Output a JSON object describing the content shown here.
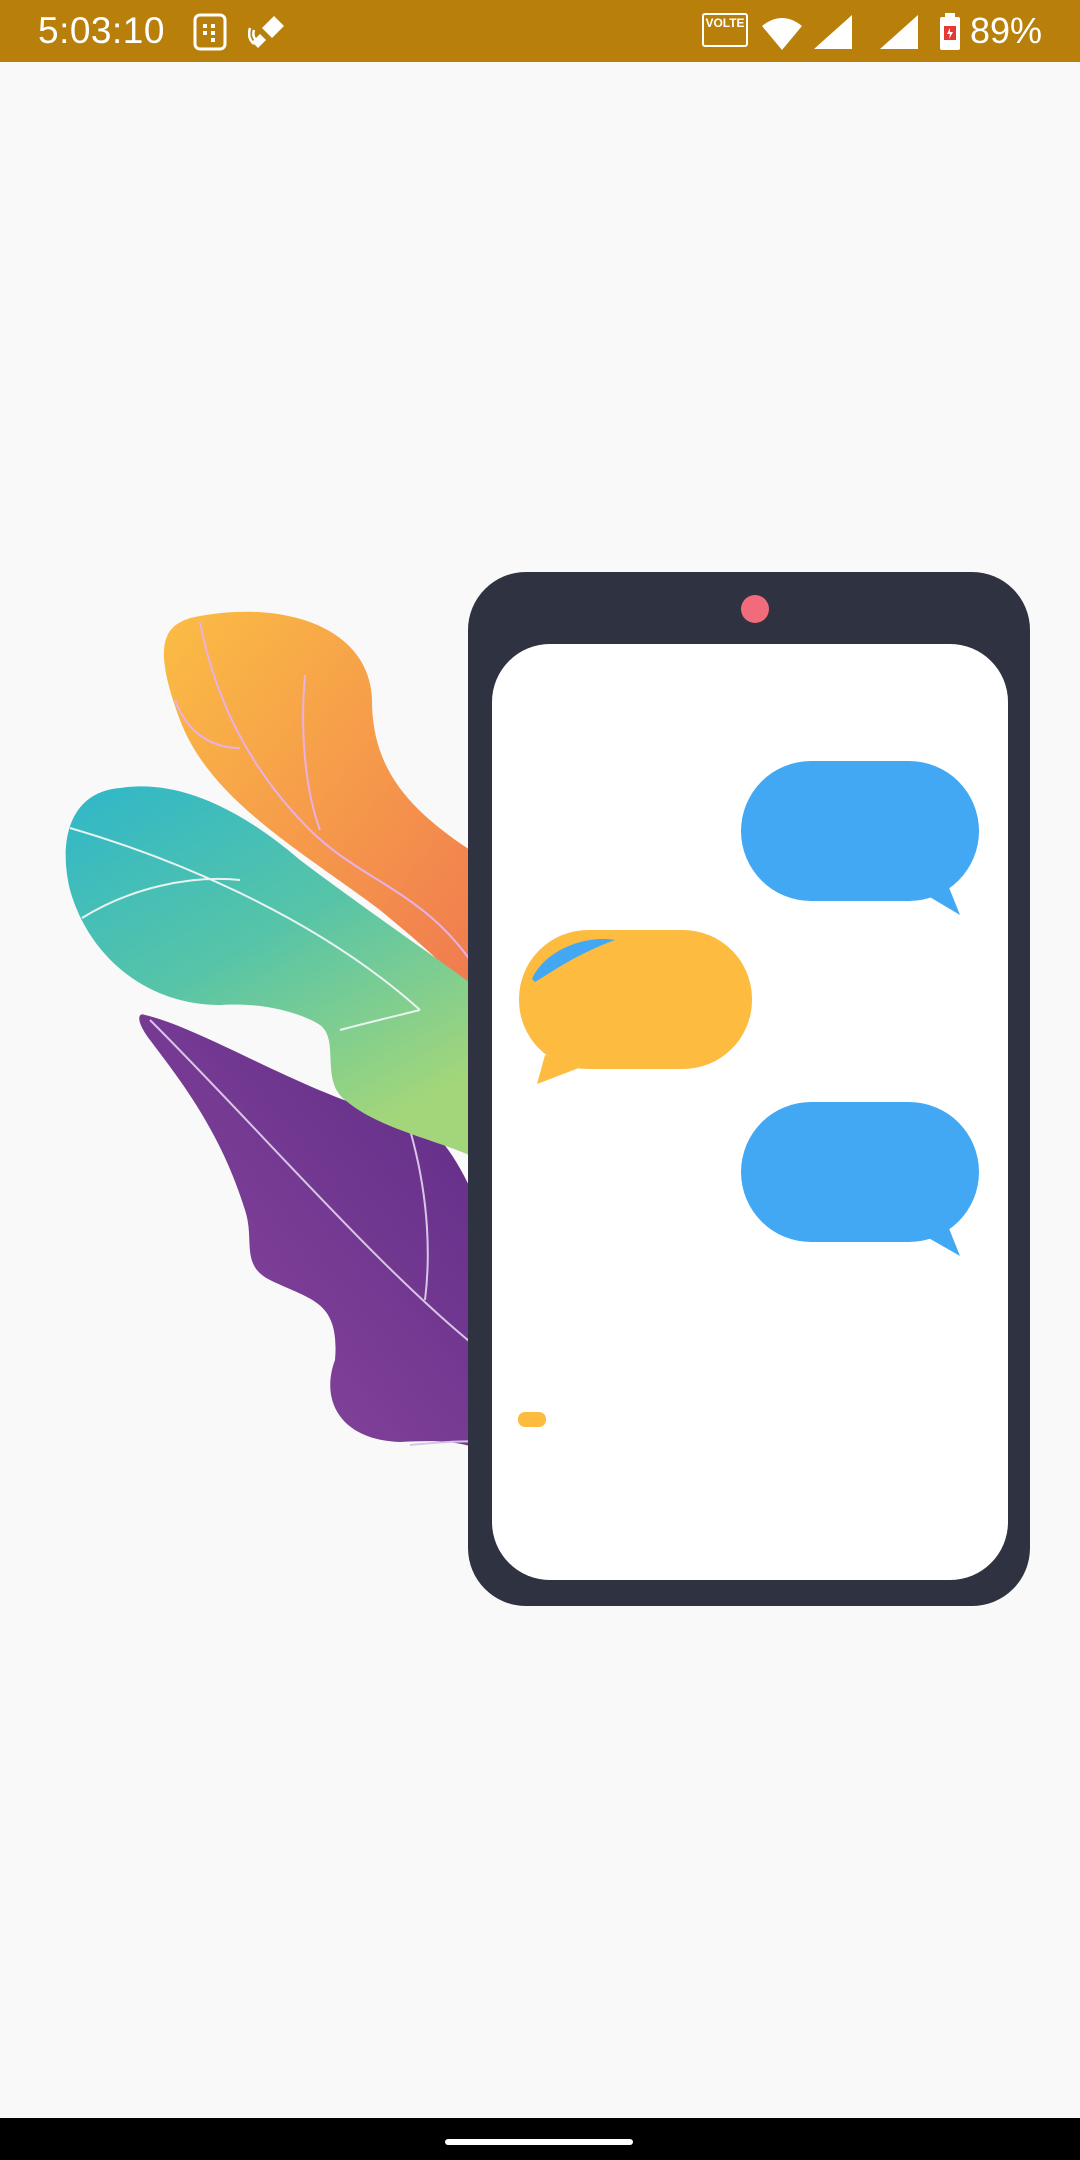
{
  "status_bar": {
    "time": "5:03:10",
    "volte_label": "VOLTE",
    "battery_percent": "89%",
    "background_color": "#b8800a",
    "icons": [
      "sim-card-icon",
      "wifi-calling-icon",
      "volte-icon",
      "wifi-icon",
      "signal-icon",
      "signal-icon-2",
      "battery-icon"
    ]
  },
  "illustration": {
    "description_icons": [
      "leaf-orange",
      "leaf-teal",
      "leaf-purple",
      "phone-frame",
      "chat-bubble-outgoing",
      "chat-bubble-incoming",
      "chat-bubble-outgoing-2"
    ],
    "colors": {
      "phone_frame": "#2f3240",
      "phone_screen": "#ffffff",
      "camera_dot": "#f26b7a",
      "bubble_blue": "#42a8f4",
      "bubble_yellow": "#fdbb40",
      "leaf_purple": "#6a2c8a",
      "leaf_orange_start": "#fbbd44",
      "leaf_orange_end": "#ee6d52",
      "leaf_teal_start": "#2fb7c9",
      "leaf_teal_end": "#9fd77c"
    }
  },
  "nav_bar": {
    "home_indicator": "home-indicator"
  }
}
